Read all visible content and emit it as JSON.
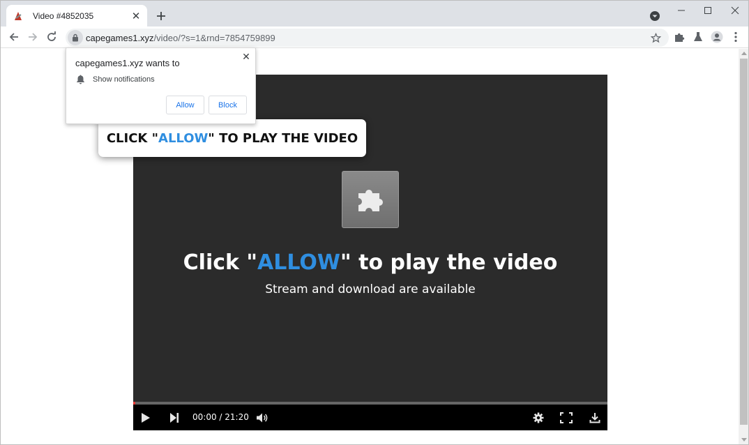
{
  "browser": {
    "tab": {
      "title": "Video #4852035",
      "favicon": "site-favicon-icon",
      "close_icon": "close-icon"
    },
    "newtab_icon": "plus-icon",
    "url": {
      "host": "capegames1.xyz",
      "path": "/video/?s=1&rnd=7854759899"
    },
    "toolbar_icons": [
      "back-icon",
      "forward-icon",
      "reload-icon",
      "lock-icon",
      "star-icon",
      "extensions-icon",
      "labs-icon",
      "profile-icon",
      "menu-icon"
    ]
  },
  "prompt": {
    "title": "capegames1.xyz wants to",
    "permission": "Show notifications",
    "allow_label": "Allow",
    "block_label": "Block"
  },
  "banner": {
    "prefix": "CLICK \"",
    "accent": "ALLOW",
    "suffix": "\" TO PLAY THE VIDEO"
  },
  "player": {
    "title_prefix": "Click \"",
    "title_accent": "ALLOW",
    "title_suffix": "\" to play the video",
    "subtitle": "Stream and download are available",
    "time": "00:00 / 21:20",
    "progress": 0
  },
  "colors": {
    "accent": "#2f8ee0",
    "player_bg": "#2b2b2b",
    "progress": "#e53935",
    "button_text": "#1a73e8"
  }
}
